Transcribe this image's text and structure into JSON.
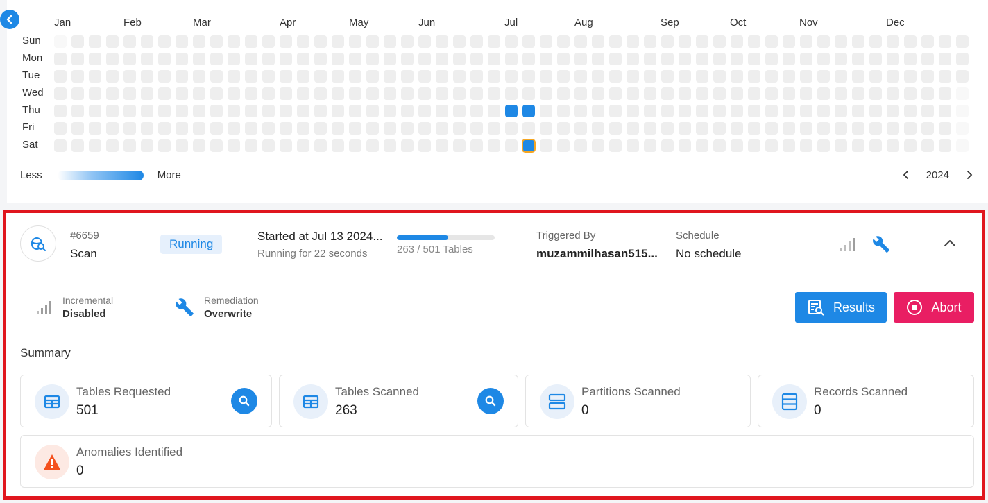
{
  "heatmap": {
    "months": [
      "Jan",
      "Feb",
      "Mar",
      "Apr",
      "May",
      "Jun",
      "Jul",
      "Aug",
      "Sep",
      "Oct",
      "Nov",
      "Dec"
    ],
    "days": [
      "Sun",
      "Mon",
      "Tue",
      "Wed",
      "Thu",
      "Fri",
      "Sat"
    ],
    "legend_less": "Less",
    "legend_more": "More",
    "year": "2024",
    "active_dates": [
      "Jul 4",
      "Jul 11",
      "Jul 13 (selected)"
    ],
    "colors": {
      "empty": "#eeeeee",
      "active": "#1e88e5",
      "selected_outline": "#f5a623"
    }
  },
  "scan": {
    "id": "#6659",
    "type": "Scan",
    "status": "Running",
    "started": "Started at Jul 13 2024...",
    "running_for": "Running for 22 seconds",
    "progress_text": "263 / 501 Tables",
    "progress_fraction": 0.525,
    "triggered_by_label": "Triggered By",
    "triggered_by": "muzammilhasan515...",
    "schedule_label": "Schedule",
    "schedule": "No schedule"
  },
  "details": {
    "incremental_label": "Incremental",
    "incremental_value": "Disabled",
    "remediation_label": "Remediation",
    "remediation_value": "Overwrite"
  },
  "buttons": {
    "results": "Results",
    "abort": "Abort"
  },
  "summary": {
    "title": "Summary",
    "metrics": [
      {
        "label": "Tables Requested",
        "value": "0501",
        "icon": "table-icon"
      },
      {
        "label": "Tables Scanned",
        "value": "263",
        "icon": "table-icon"
      },
      {
        "label": "Partitions Scanned",
        "value": "0",
        "icon": "partition-icon"
      },
      {
        "label": "Records Scanned",
        "value": "0",
        "icon": "records-icon"
      },
      {
        "label": "Anomalies Identified",
        "value": "0",
        "icon": "warning-icon"
      }
    ]
  },
  "theme": {
    "accent": "#1e88e5",
    "danger": "#e91e63",
    "highlight_border": "#e0161e",
    "warning": "#f4511e"
  }
}
